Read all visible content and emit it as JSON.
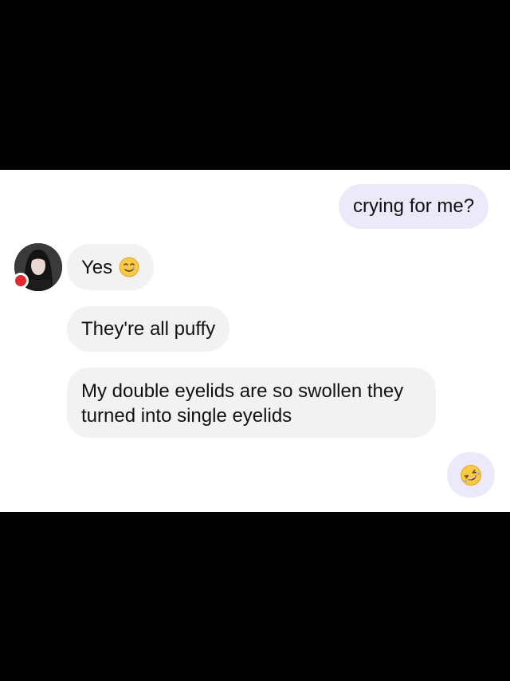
{
  "messages": [
    {
      "id": "m1",
      "direction": "sent",
      "text": "crying for me?"
    },
    {
      "id": "m2",
      "direction": "received",
      "text": "Yes",
      "emoji": "smiling-face-with-tear"
    },
    {
      "id": "m3",
      "direction": "received",
      "text": "They're all puffy"
    },
    {
      "id": "m4",
      "direction": "received",
      "text": "My double eyelids are so swollen they turned into single eyelids"
    },
    {
      "id": "m5",
      "direction": "sent",
      "text": "",
      "emoji": "rolling-on-the-floor-laughing"
    }
  ],
  "contact": {
    "avatar": "contact-avatar-photo",
    "status_color": "#e4262f"
  },
  "colors": {
    "sent_bubble": "#ece9fb",
    "received_bubble": "#f2f2f3",
    "text": "#111111",
    "letterbox": "#000000"
  }
}
